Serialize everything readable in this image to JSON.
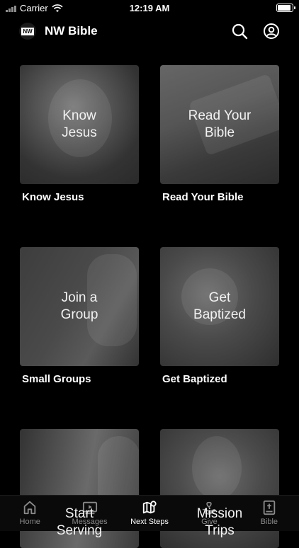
{
  "status": {
    "carrier": "Carrier",
    "time": "12:19 AM",
    "battery_fraction": 1.0
  },
  "header": {
    "logo_text": "NW",
    "title": "NW Bible",
    "search_icon": "search-icon",
    "account_icon": "account-icon"
  },
  "cards": [
    {
      "overlay": "Know\nJesus",
      "caption": "Know Jesus"
    },
    {
      "overlay": "Read Your\nBible",
      "caption": "Read Your Bible"
    },
    {
      "overlay": "Join a\nGroup",
      "caption": "Small Groups"
    },
    {
      "overlay": "Get\nBaptized",
      "caption": "Get Baptized"
    },
    {
      "overlay": "Start\nServing",
      "caption": ""
    },
    {
      "overlay": "Mission\nTrips",
      "caption": ""
    }
  ],
  "tabs": [
    {
      "label": "Home",
      "icon": "home-icon"
    },
    {
      "label": "Messages",
      "icon": "play-icon"
    },
    {
      "label": "Next Steps",
      "icon": "map-icon"
    },
    {
      "label": "Give",
      "icon": "give-icon"
    },
    {
      "label": "Bible",
      "icon": "bible-icon"
    }
  ],
  "active_tab": "Next Steps"
}
